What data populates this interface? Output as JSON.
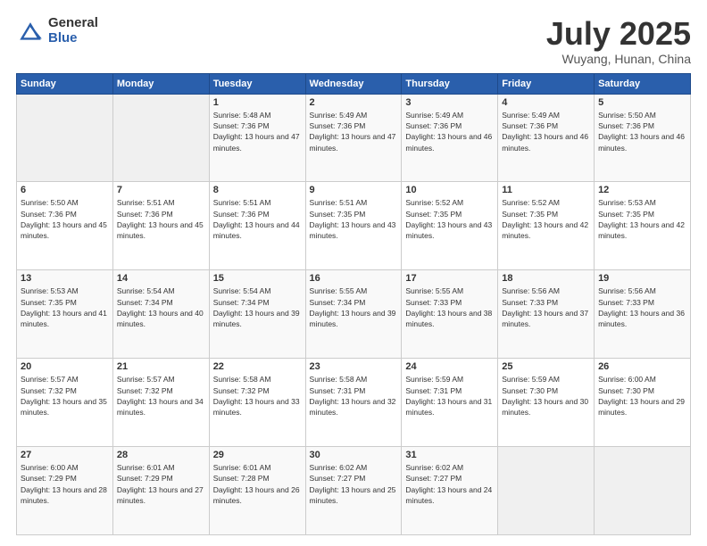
{
  "logo": {
    "general": "General",
    "blue": "Blue"
  },
  "header": {
    "month": "July 2025",
    "location": "Wuyang, Hunan, China"
  },
  "weekdays": [
    "Sunday",
    "Monday",
    "Tuesday",
    "Wednesday",
    "Thursday",
    "Friday",
    "Saturday"
  ],
  "weeks": [
    [
      {
        "day": "",
        "info": ""
      },
      {
        "day": "",
        "info": ""
      },
      {
        "day": "1",
        "info": "Sunrise: 5:48 AM\nSunset: 7:36 PM\nDaylight: 13 hours and 47 minutes."
      },
      {
        "day": "2",
        "info": "Sunrise: 5:49 AM\nSunset: 7:36 PM\nDaylight: 13 hours and 47 minutes."
      },
      {
        "day": "3",
        "info": "Sunrise: 5:49 AM\nSunset: 7:36 PM\nDaylight: 13 hours and 46 minutes."
      },
      {
        "day": "4",
        "info": "Sunrise: 5:49 AM\nSunset: 7:36 PM\nDaylight: 13 hours and 46 minutes."
      },
      {
        "day": "5",
        "info": "Sunrise: 5:50 AM\nSunset: 7:36 PM\nDaylight: 13 hours and 46 minutes."
      }
    ],
    [
      {
        "day": "6",
        "info": "Sunrise: 5:50 AM\nSunset: 7:36 PM\nDaylight: 13 hours and 45 minutes."
      },
      {
        "day": "7",
        "info": "Sunrise: 5:51 AM\nSunset: 7:36 PM\nDaylight: 13 hours and 45 minutes."
      },
      {
        "day": "8",
        "info": "Sunrise: 5:51 AM\nSunset: 7:36 PM\nDaylight: 13 hours and 44 minutes."
      },
      {
        "day": "9",
        "info": "Sunrise: 5:51 AM\nSunset: 7:35 PM\nDaylight: 13 hours and 43 minutes."
      },
      {
        "day": "10",
        "info": "Sunrise: 5:52 AM\nSunset: 7:35 PM\nDaylight: 13 hours and 43 minutes."
      },
      {
        "day": "11",
        "info": "Sunrise: 5:52 AM\nSunset: 7:35 PM\nDaylight: 13 hours and 42 minutes."
      },
      {
        "day": "12",
        "info": "Sunrise: 5:53 AM\nSunset: 7:35 PM\nDaylight: 13 hours and 42 minutes."
      }
    ],
    [
      {
        "day": "13",
        "info": "Sunrise: 5:53 AM\nSunset: 7:35 PM\nDaylight: 13 hours and 41 minutes."
      },
      {
        "day": "14",
        "info": "Sunrise: 5:54 AM\nSunset: 7:34 PM\nDaylight: 13 hours and 40 minutes."
      },
      {
        "day": "15",
        "info": "Sunrise: 5:54 AM\nSunset: 7:34 PM\nDaylight: 13 hours and 39 minutes."
      },
      {
        "day": "16",
        "info": "Sunrise: 5:55 AM\nSunset: 7:34 PM\nDaylight: 13 hours and 39 minutes."
      },
      {
        "day": "17",
        "info": "Sunrise: 5:55 AM\nSunset: 7:33 PM\nDaylight: 13 hours and 38 minutes."
      },
      {
        "day": "18",
        "info": "Sunrise: 5:56 AM\nSunset: 7:33 PM\nDaylight: 13 hours and 37 minutes."
      },
      {
        "day": "19",
        "info": "Sunrise: 5:56 AM\nSunset: 7:33 PM\nDaylight: 13 hours and 36 minutes."
      }
    ],
    [
      {
        "day": "20",
        "info": "Sunrise: 5:57 AM\nSunset: 7:32 PM\nDaylight: 13 hours and 35 minutes."
      },
      {
        "day": "21",
        "info": "Sunrise: 5:57 AM\nSunset: 7:32 PM\nDaylight: 13 hours and 34 minutes."
      },
      {
        "day": "22",
        "info": "Sunrise: 5:58 AM\nSunset: 7:32 PM\nDaylight: 13 hours and 33 minutes."
      },
      {
        "day": "23",
        "info": "Sunrise: 5:58 AM\nSunset: 7:31 PM\nDaylight: 13 hours and 32 minutes."
      },
      {
        "day": "24",
        "info": "Sunrise: 5:59 AM\nSunset: 7:31 PM\nDaylight: 13 hours and 31 minutes."
      },
      {
        "day": "25",
        "info": "Sunrise: 5:59 AM\nSunset: 7:30 PM\nDaylight: 13 hours and 30 minutes."
      },
      {
        "day": "26",
        "info": "Sunrise: 6:00 AM\nSunset: 7:30 PM\nDaylight: 13 hours and 29 minutes."
      }
    ],
    [
      {
        "day": "27",
        "info": "Sunrise: 6:00 AM\nSunset: 7:29 PM\nDaylight: 13 hours and 28 minutes."
      },
      {
        "day": "28",
        "info": "Sunrise: 6:01 AM\nSunset: 7:29 PM\nDaylight: 13 hours and 27 minutes."
      },
      {
        "day": "29",
        "info": "Sunrise: 6:01 AM\nSunset: 7:28 PM\nDaylight: 13 hours and 26 minutes."
      },
      {
        "day": "30",
        "info": "Sunrise: 6:02 AM\nSunset: 7:27 PM\nDaylight: 13 hours and 25 minutes."
      },
      {
        "day": "31",
        "info": "Sunrise: 6:02 AM\nSunset: 7:27 PM\nDaylight: 13 hours and 24 minutes."
      },
      {
        "day": "",
        "info": ""
      },
      {
        "day": "",
        "info": ""
      }
    ]
  ]
}
